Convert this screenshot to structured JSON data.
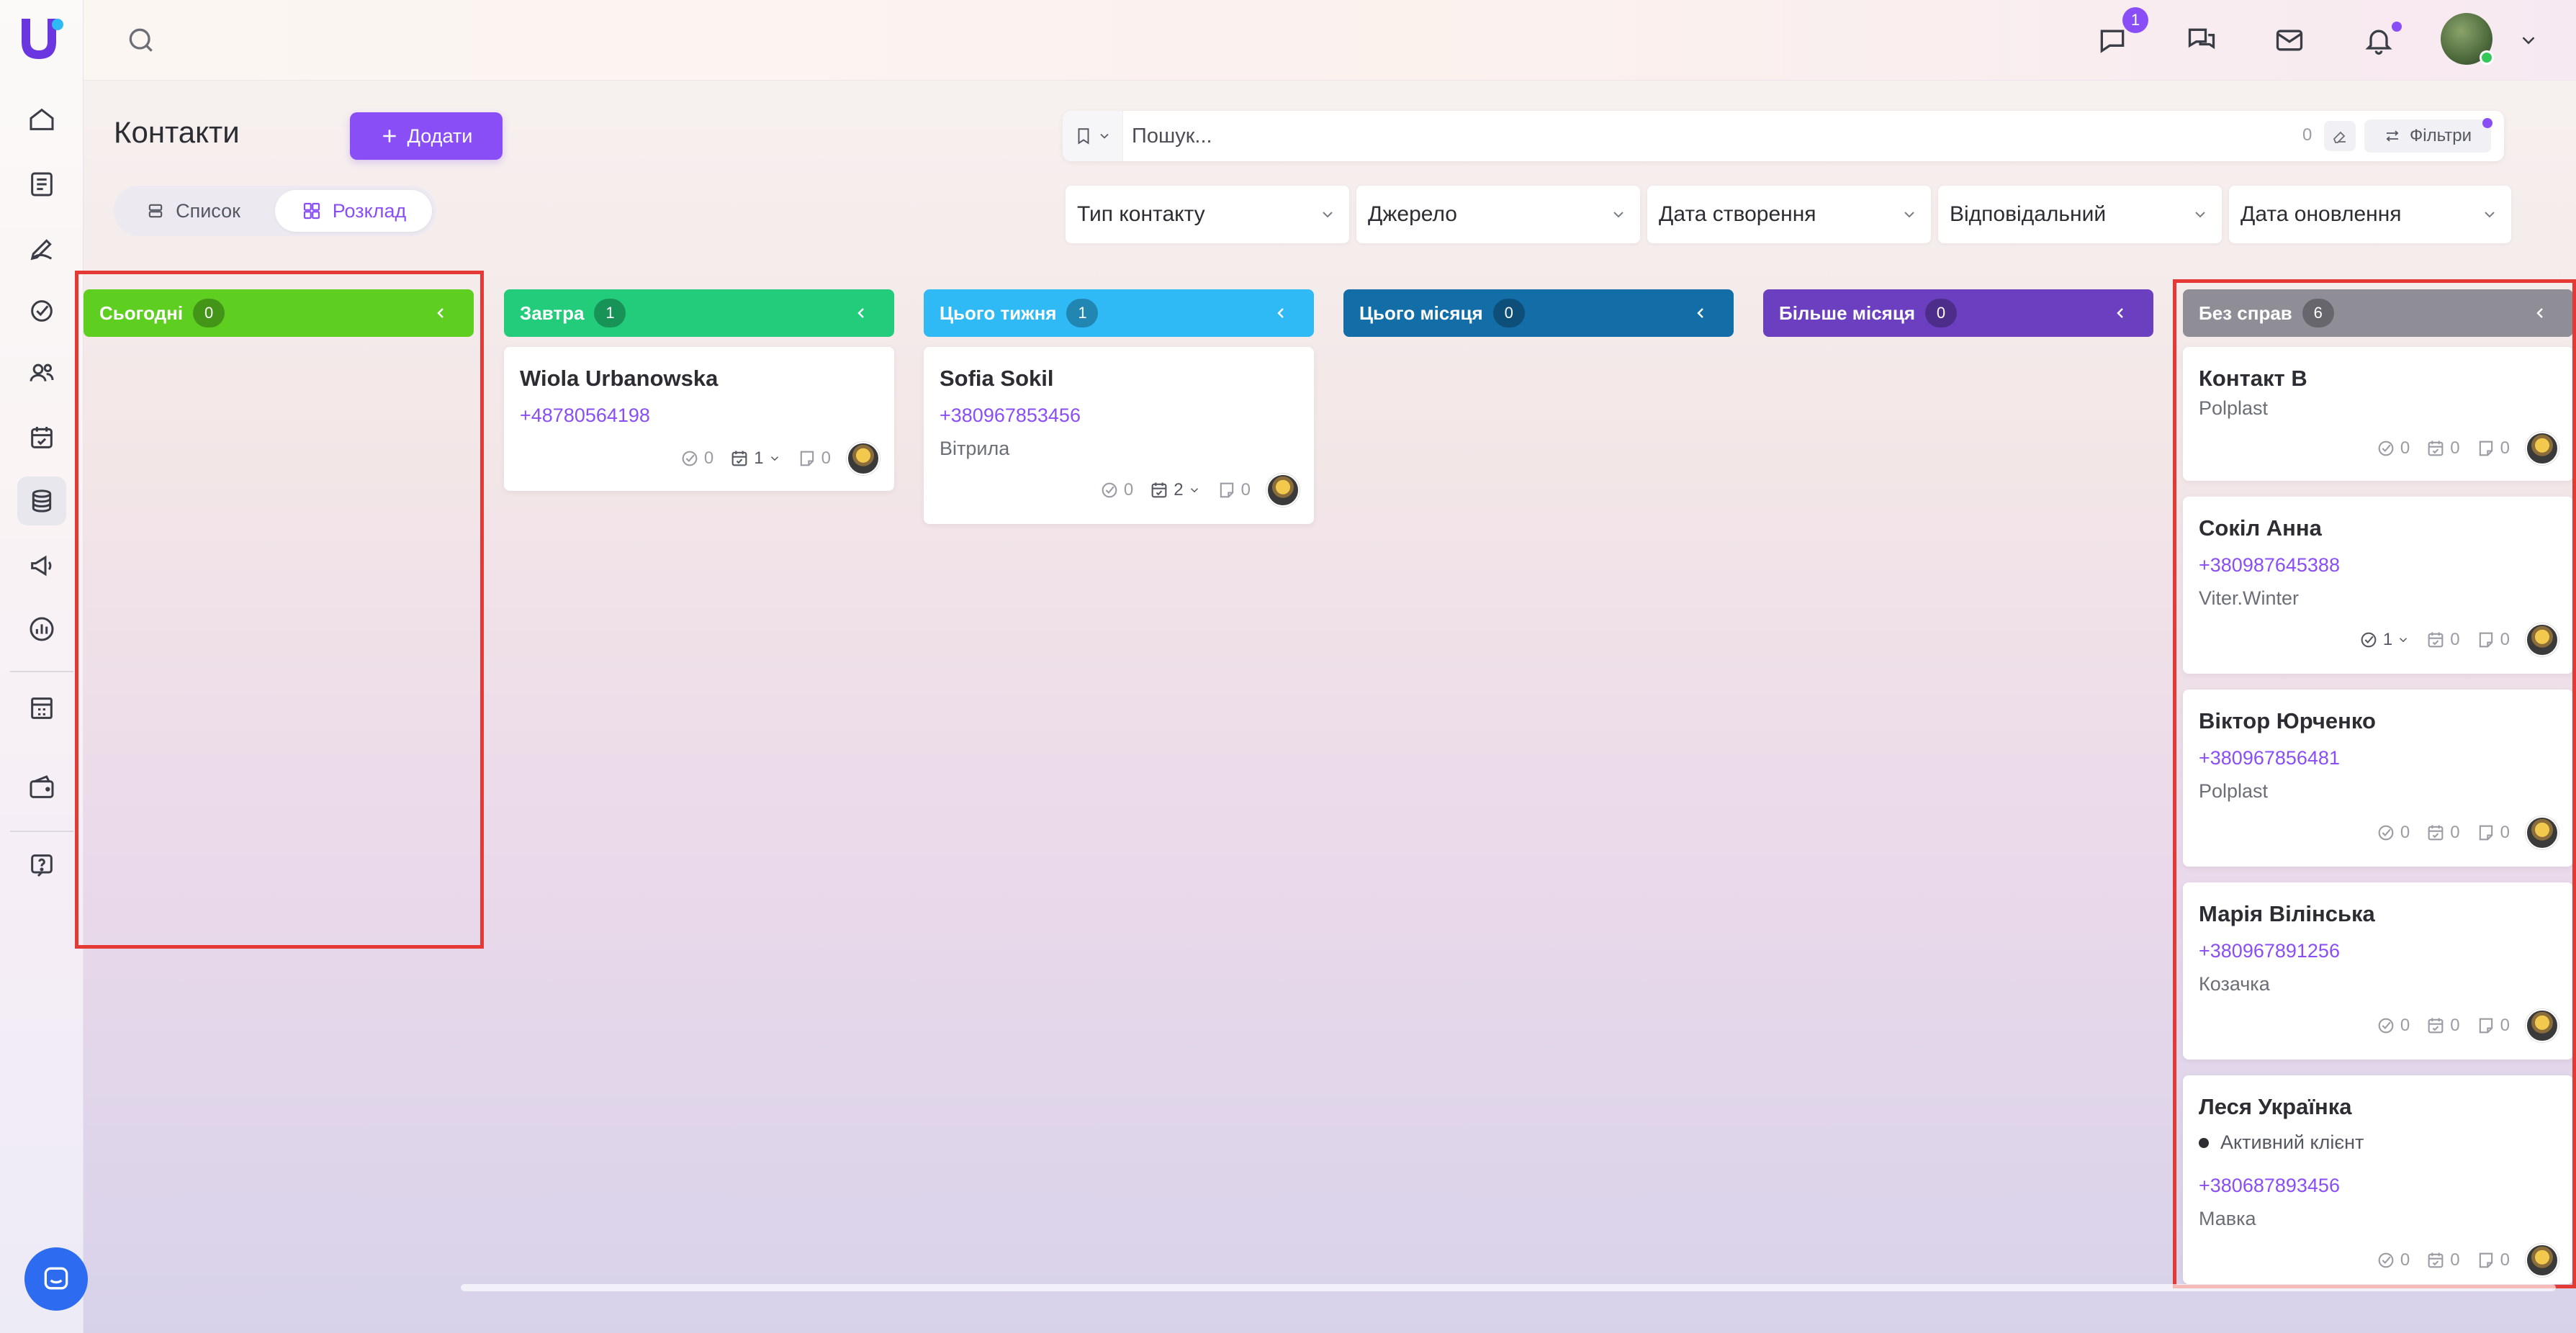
{
  "topbar": {
    "message_badge": "1"
  },
  "header": {
    "title": "Контакти",
    "add_label": "Додати",
    "views": [
      {
        "label": "Список",
        "active": false
      },
      {
        "label": "Розклад",
        "active": true
      }
    ]
  },
  "search": {
    "placeholder": "Пошук...",
    "count": "0",
    "filters_label": "Фільтри"
  },
  "filters": [
    "Тип контакту",
    "Джерело",
    "Дата створення",
    "Відповідальний",
    "Дата оновлення"
  ],
  "columns": [
    {
      "title": "Сьогодні",
      "count": "0",
      "color": "#5ecf20",
      "cards": []
    },
    {
      "title": "Завтра",
      "count": "1",
      "color": "#22cc7a",
      "cards": [
        {
          "name": "Wiola Urbanowska",
          "phone": "+48780564198",
          "tasks": "0",
          "events": "1",
          "notes": "0"
        }
      ]
    },
    {
      "title": "Цього тижня",
      "count": "1",
      "color": "#2fbaf5",
      "cards": [
        {
          "name": "Sofia Sokil",
          "phone": "+380967853456",
          "company": "Вітрила",
          "tasks": "0",
          "events": "2",
          "notes": "0"
        }
      ]
    },
    {
      "title": "Цього місяця",
      "count": "0",
      "color": "#136ea8",
      "cards": []
    },
    {
      "title": "Більше місяця",
      "count": "0",
      "color": "#6b3fc0",
      "cards": []
    },
    {
      "title": "Без справ",
      "count": "6",
      "color": "#8f8e96",
      "cards": [
        {
          "name": "Контакт В",
          "company": "Polplast",
          "tasks": "0",
          "events": "0",
          "notes": "0"
        },
        {
          "name": "Сокіл Анна",
          "phone": "+380987645388",
          "company": "Viter.Winter",
          "tasks": "1",
          "events": "0",
          "notes": "0"
        },
        {
          "name": "Віктор Юрченко",
          "phone": "+380967856481",
          "company": "Polplast",
          "tasks": "0",
          "events": "0",
          "notes": "0"
        },
        {
          "name": "Марія Вілінська",
          "phone": "+380967891256",
          "company": "Козачка",
          "tasks": "0",
          "events": "0",
          "notes": "0"
        },
        {
          "name": "Леся Українка",
          "status": "Активний клієнт",
          "phone": "+380687893456",
          "company": "Мавка",
          "tasks": "0",
          "events": "0",
          "notes": "0"
        }
      ]
    }
  ],
  "icons": {
    "sidebar": [
      "home-icon",
      "spreadsheet-icon",
      "pen-icon",
      "check-circle-icon",
      "users-icon",
      "calendar-check-icon",
      "database-icon",
      "megaphone-icon",
      "chart-icon",
      "building-icon",
      "wallet-icon",
      "help-icon"
    ],
    "top": [
      "search-icon",
      "message-icon",
      "chat-icon",
      "mail-icon",
      "bell-icon",
      "chevron-down-icon"
    ]
  },
  "accent": "#8a4ef6"
}
